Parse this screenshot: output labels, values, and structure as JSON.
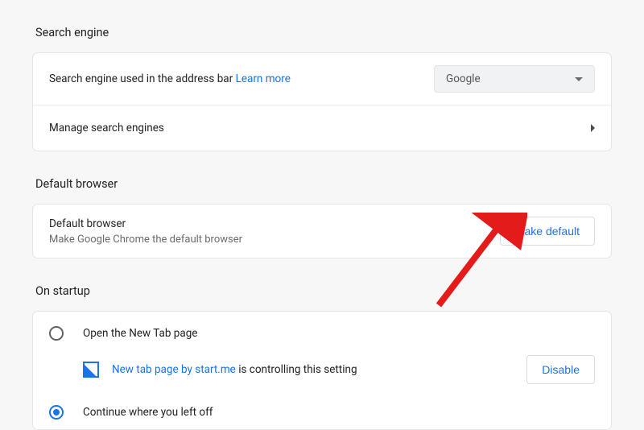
{
  "sections": {
    "search_engine": {
      "title": "Search engine",
      "row1_label": "Search engine used in the address bar",
      "learn_more": "Learn more",
      "dropdown_value": "Google",
      "row2_label": "Manage search engines"
    },
    "default_browser": {
      "title": "Default browser",
      "row_title": "Default browser",
      "row_sub": "Make Google Chrome the default browser",
      "button": "Make default"
    },
    "on_startup": {
      "title": "On startup",
      "opt1": "Open the New Tab page",
      "ext_link": "New tab page by start.me",
      "ext_suffix": " is controlling this setting",
      "ext_button": "Disable",
      "opt2": "Continue where you left off"
    }
  }
}
